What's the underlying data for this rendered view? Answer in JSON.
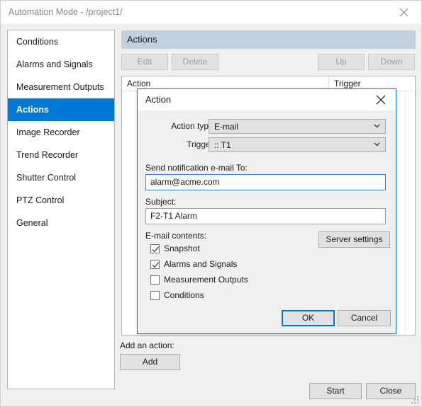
{
  "window": {
    "title": "Automation Mode - /project1/",
    "close_icon": "close-icon"
  },
  "sidebar": {
    "items": [
      {
        "label": "Conditions",
        "selected": false
      },
      {
        "label": "Alarms and Signals",
        "selected": false
      },
      {
        "label": "Measurement Outputs",
        "selected": false
      },
      {
        "label": "Actions",
        "selected": true
      },
      {
        "label": "Image Recorder",
        "selected": false
      },
      {
        "label": "Trend Recorder",
        "selected": false
      },
      {
        "label": "Shutter Control",
        "selected": false
      },
      {
        "label": "PTZ Control",
        "selected": false
      },
      {
        "label": "General",
        "selected": false
      }
    ],
    "selected_color": "#0078d7"
  },
  "panel": {
    "header": "Actions",
    "header_bg": "#c3d0dd",
    "toolbar": {
      "edit": "Edit",
      "delete": "Delete",
      "up": "Up",
      "down": "Down",
      "disabled": true
    },
    "list": {
      "columns": [
        "Action",
        "Trigger"
      ],
      "rows": []
    },
    "add_action_label": "Add an action:",
    "add_button": "Add",
    "start_button": "Start",
    "close_button": "Close"
  },
  "dialog": {
    "title": "Action",
    "close_icon": "close-icon",
    "action_type": {
      "label": "Action type:",
      "value": "E-mail"
    },
    "trigger": {
      "label": "Trigger:",
      "value": ":: T1"
    },
    "send_to": {
      "label": "Send notification e-mail To:",
      "value": "alarm@acme.com",
      "focused": true
    },
    "subject": {
      "label": "Subject:",
      "value": "F2-T1 Alarm"
    },
    "contents": {
      "label": "E-mail contents:",
      "items": [
        {
          "label": "Snapshot",
          "checked": true
        },
        {
          "label": "Alarms and Signals",
          "checked": true
        },
        {
          "label": "Measurement Outputs",
          "checked": false
        },
        {
          "label": "Conditions",
          "checked": false
        }
      ]
    },
    "server_settings_button": "Server settings",
    "ok_button": "OK",
    "cancel_button": "Cancel",
    "accent_color": "#0078d7"
  }
}
